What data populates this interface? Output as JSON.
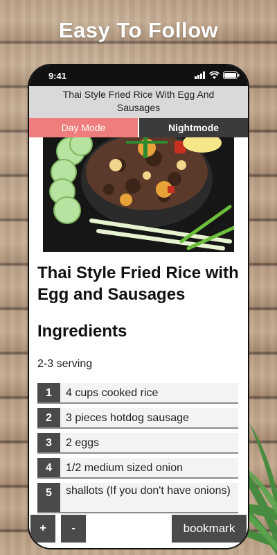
{
  "promo": {
    "headline": "Easy To Follow"
  },
  "status": {
    "time": "9:41"
  },
  "titlebar": {
    "title_line1": "Thai Style Fried Rice With Egg And",
    "title_line2": "Sausages"
  },
  "modes": {
    "day_label": "Day Mode",
    "night_label": "Nightmode",
    "active": "Day Mode"
  },
  "recipe": {
    "title": "Thai Style Fried Rice with Egg and Sausages",
    "section_title": "Ingredients",
    "serving": "2-3 serving",
    "ingredients": [
      {
        "num": "1",
        "text": "4 cups cooked rice"
      },
      {
        "num": "2",
        "text": "3 pieces hotdog sausage"
      },
      {
        "num": "3",
        "text": "2 eggs"
      },
      {
        "num": "4",
        "text": "1/2 medium sized onion"
      },
      {
        "num": "5",
        "text": "shallots (If you don't have onions)"
      }
    ]
  },
  "controls": {
    "plus_label": "+",
    "minus_label": "-",
    "bookmark_label": "bookmark"
  },
  "colors": {
    "day_mode": "#ef7d7d",
    "night_mode": "#3b3b3b",
    "number_badge": "#4a4a4a"
  }
}
